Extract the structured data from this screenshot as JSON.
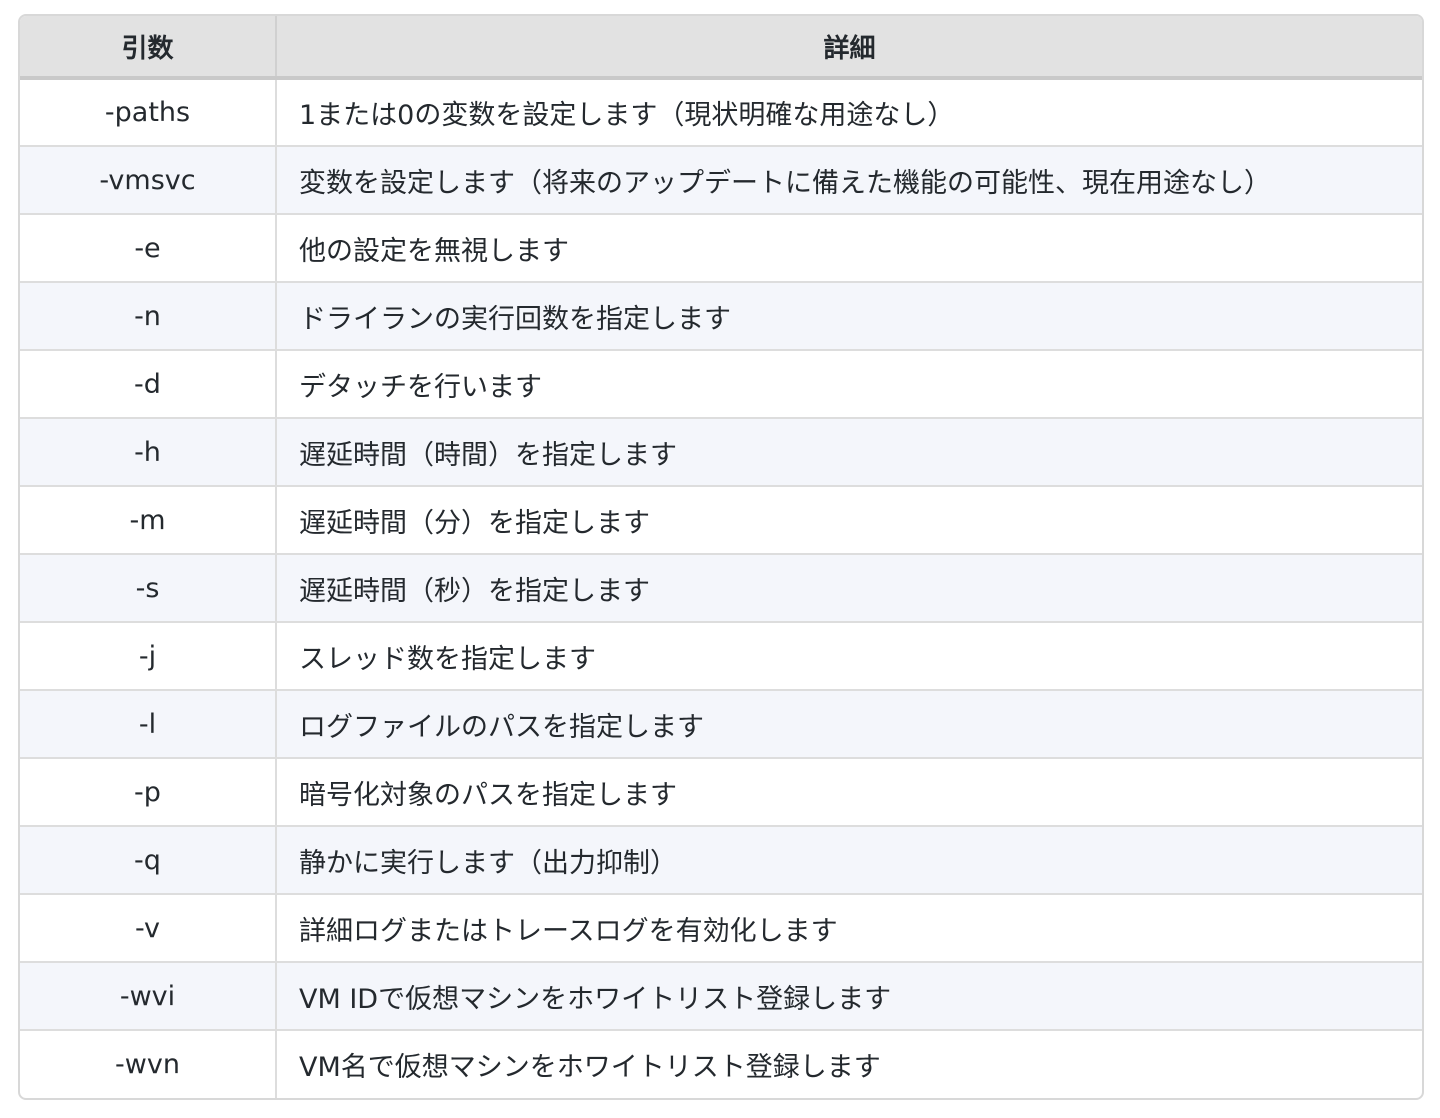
{
  "table": {
    "headers": [
      "引数",
      "詳細"
    ],
    "rows": [
      {
        "arg": "-paths",
        "detail": "1または0の変数を設定します（現状明確な用途なし）"
      },
      {
        "arg": "-vmsvc",
        "detail": "変数を設定します（将来のアップデートに備えた機能の可能性、現在用途なし）"
      },
      {
        "arg": "-e",
        "detail": "他の設定を無視します"
      },
      {
        "arg": "-n",
        "detail": "ドライランの実行回数を指定します"
      },
      {
        "arg": "-d",
        "detail": "デタッチを行います"
      },
      {
        "arg": "-h",
        "detail": "遅延時間（時間）を指定します"
      },
      {
        "arg": "-m",
        "detail": "遅延時間（分）を指定します"
      },
      {
        "arg": "-s",
        "detail": "遅延時間（秒）を指定します"
      },
      {
        "arg": "-j",
        "detail": "スレッド数を指定します"
      },
      {
        "arg": "-l",
        "detail": "ログファイルのパスを指定します"
      },
      {
        "arg": "-p",
        "detail": "暗号化対象のパスを指定します"
      },
      {
        "arg": "-q",
        "detail": "静かに実行します（出力抑制）"
      },
      {
        "arg": "-v",
        "detail": "詳細ログまたはトレースログを有効化します"
      },
      {
        "arg": "-wvi",
        "detail": "VM IDで仮想マシンをホワイトリスト登録します"
      },
      {
        "arg": "-wvn",
        "detail": "VM名で仮想マシンをホワイトリスト登録します"
      }
    ]
  }
}
